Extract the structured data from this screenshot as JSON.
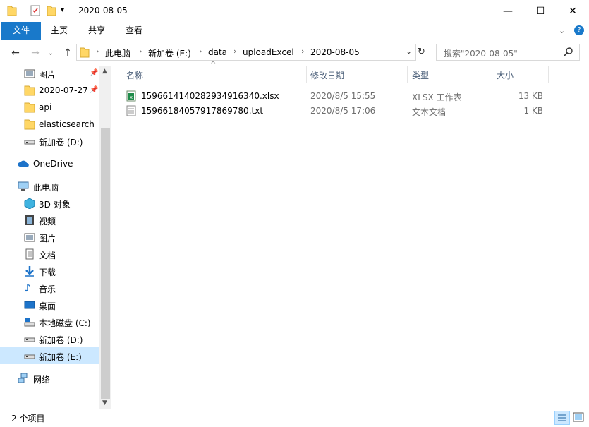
{
  "window": {
    "title": "2020-08-05",
    "controls": {
      "minimize": "—",
      "maximize": "☐",
      "close": "✕"
    }
  },
  "ribbon": {
    "tabs": [
      "文件",
      "主页",
      "共享",
      "查看"
    ]
  },
  "address": {
    "crumbs": [
      "此电脑",
      "新加卷 (E:)",
      "data",
      "uploadExcel",
      "2020-08-05"
    ]
  },
  "search": {
    "placeholder": "搜索\"2020-08-05\""
  },
  "nav": {
    "items": [
      {
        "label": "图片",
        "icon": "pictures-icon",
        "pinned": true
      },
      {
        "label": "2020-07-27",
        "icon": "folder-icon",
        "pinned": true
      },
      {
        "label": "api",
        "icon": "folder-icon"
      },
      {
        "label": "elasticsearch",
        "icon": "folder-icon"
      },
      {
        "label": "新加卷 (D:)",
        "icon": "drive-icon"
      },
      {
        "label": "OneDrive",
        "icon": "onedrive-icon"
      },
      {
        "label": "此电脑",
        "icon": "this-pc-icon"
      },
      {
        "label": "3D 对象",
        "icon": "3d-objects-icon"
      },
      {
        "label": "视频",
        "icon": "videos-icon"
      },
      {
        "label": "图片",
        "icon": "pictures-icon"
      },
      {
        "label": "文档",
        "icon": "documents-icon"
      },
      {
        "label": "下载",
        "icon": "downloads-icon"
      },
      {
        "label": "音乐",
        "icon": "music-icon"
      },
      {
        "label": "桌面",
        "icon": "desktop-icon"
      },
      {
        "label": "本地磁盘 (C:)",
        "icon": "system-drive-icon"
      },
      {
        "label": "新加卷 (D:)",
        "icon": "drive-icon"
      },
      {
        "label": "新加卷 (E:)",
        "icon": "drive-icon",
        "selected": true
      },
      {
        "label": "网络",
        "icon": "network-icon"
      }
    ]
  },
  "list": {
    "columns": [
      "名称",
      "修改日期",
      "类型",
      "大小"
    ],
    "rows": [
      {
        "name": "1596614140282934916340.xlsx",
        "modified": "2020/8/5 15:55",
        "type": "XLSX 工作表",
        "size": "13 KB",
        "icon": "excel-file-icon"
      },
      {
        "name": "15966184057917869780.txt",
        "modified": "2020/8/5 17:06",
        "type": "文本文档",
        "size": "1 KB",
        "icon": "text-file-icon"
      }
    ]
  },
  "status": {
    "item_count": "2 个项目"
  },
  "colors": {
    "accent": "#1979ca",
    "selected": "#cce8ff",
    "folder": "#ffd766"
  }
}
